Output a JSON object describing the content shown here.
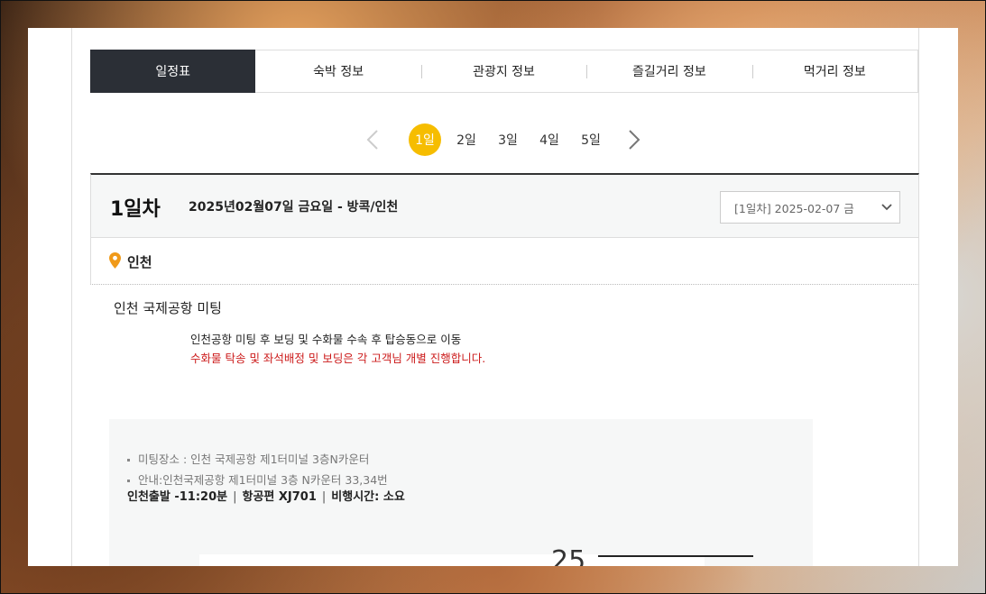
{
  "tabs": [
    {
      "label": "일정표",
      "active": true
    },
    {
      "label": "숙박 정보"
    },
    {
      "label": "관광지 정보"
    },
    {
      "label": "즐길거리 정보"
    },
    {
      "label": "먹거리 정보"
    }
  ],
  "day_nav": {
    "days": [
      "1일",
      "2일",
      "3일",
      "4일",
      "5일"
    ],
    "active_index": 0
  },
  "day_header": {
    "day_title": "1일차",
    "description": "2025년02월07일 금요일 - 방콕/인천",
    "select_value": "[1일차] 2025-02-07 금"
  },
  "location": {
    "name": "인천"
  },
  "event": {
    "title": "인천 국제공항 미팅",
    "description": "인천공항 미팅 후 보딩 및 수화물 수속 후 탑승동으로 이동",
    "warning": "수화물 탁송 및 좌석배정 및 보딩은 각 고객님 개별 진행합니다."
  },
  "info": {
    "meeting_place": "미팅장소 : 인천 국제공항 제1터미널 3층N카운터",
    "guide": "안내:인천국제공항 제1터미널 3층 N카운터 33,34번",
    "departure": "인천출발 -11:20분",
    "flight": "항공편 XJ701",
    "flight_time": "비행시간: 소요",
    "partial_number": "25"
  },
  "colors": {
    "active_tab": "#2b2f36",
    "active_day": "#f6bd00",
    "warning": "#cc1b1b",
    "pin": "#f09a1a"
  }
}
